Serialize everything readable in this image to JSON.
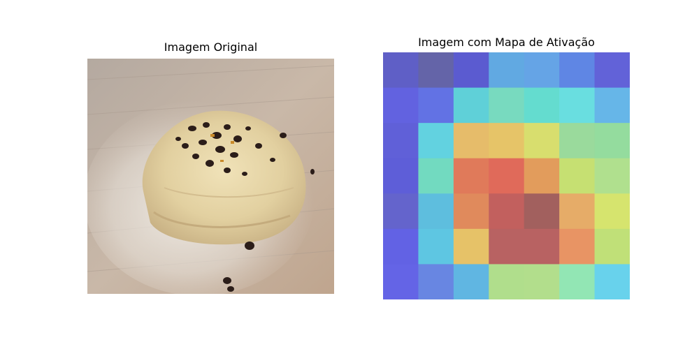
{
  "panels": {
    "left_title": "Imagem Original",
    "right_title": "Imagem com Mapa de Ativação"
  },
  "photo": {
    "subject": "dough-with-raisins-on-floured-board"
  },
  "chart_data": {
    "type": "heatmap",
    "title": "Imagem com Mapa de Ativação",
    "rows": 7,
    "cols": 7,
    "values": [
      [
        0.05,
        0.02,
        0.08,
        0.4,
        0.38,
        0.25,
        0.1
      ],
      [
        0.1,
        0.15,
        0.55,
        0.62,
        0.58,
        0.55,
        0.4
      ],
      [
        0.08,
        0.52,
        0.8,
        0.82,
        0.72,
        0.65,
        0.65
      ],
      [
        0.07,
        0.6,
        0.92,
        0.95,
        0.88,
        0.72,
        0.7
      ],
      [
        0.06,
        0.42,
        0.9,
        0.98,
        0.99,
        0.85,
        0.75
      ],
      [
        0.1,
        0.48,
        0.82,
        0.97,
        0.97,
        0.9,
        0.72
      ],
      [
        0.12,
        0.22,
        0.45,
        0.68,
        0.68,
        0.62,
        0.5
      ]
    ],
    "colors": [
      [
        "#5f5fc6",
        "#6464a8",
        "#5b5bd0",
        "#61a9e2",
        "#65a4e6",
        "#5f86e4",
        "#6262d8"
      ],
      [
        "#6262e0",
        "#6272e4",
        "#5fd0d8",
        "#78dabf",
        "#64dccf",
        "#69dee0",
        "#66b6e8"
      ],
      [
        "#6060d8",
        "#62d2e0",
        "#e6bc6a",
        "#e6c468",
        "#d8de6e",
        "#9ada9c",
        "#94dc9e"
      ],
      [
        "#5e5ed8",
        "#72dac0",
        "#e07a5a",
        "#e06a5a",
        "#e29c5c",
        "#c6e072",
        "#b0e08e"
      ],
      [
        "#6464cc",
        "#5ebede",
        "#e08a5c",
        "#c2605e",
        "#a2605e",
        "#e6ac68",
        "#d6e46e"
      ],
      [
        "#6262e4",
        "#5ec6e2",
        "#e6c268",
        "#b86262",
        "#b86262",
        "#e89464",
        "#c0e078"
      ],
      [
        "#6464e6",
        "#6886e2",
        "#60b6e2",
        "#b0de8c",
        "#b2de8c",
        "#92e6b4",
        "#68d2ec"
      ]
    ]
  }
}
